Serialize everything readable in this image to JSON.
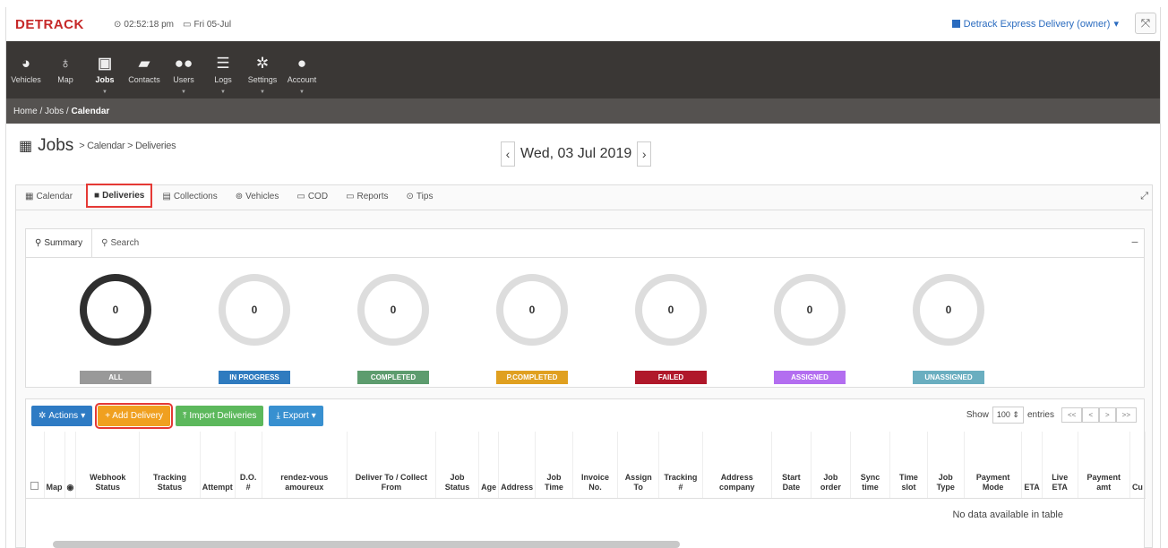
{
  "app": {
    "logo": "DETRACK",
    "time": "02:52:18 pm",
    "date": "Fri 05-Jul",
    "company": "Detrack Express Delivery (owner)"
  },
  "nav": [
    {
      "label": "Vehicles",
      "icon": "tachometer-icon"
    },
    {
      "label": "Map",
      "icon": "map-pin-icon"
    },
    {
      "label": "Jobs",
      "icon": "briefcase-icon",
      "active": true
    },
    {
      "label": "Contacts",
      "icon": "book-icon"
    },
    {
      "label": "Users",
      "icon": "users-icon"
    },
    {
      "label": "Logs",
      "icon": "list-icon"
    },
    {
      "label": "Settings",
      "icon": "gear-icon"
    },
    {
      "label": "Account",
      "icon": "user-icon"
    }
  ],
  "breadcrumb": {
    "home": "Home",
    "jobs": "Jobs",
    "current": "Calendar"
  },
  "page": {
    "title": "Jobs",
    "subtitle": "> Calendar > Deliveries",
    "current_date": "Wed, 03 Jul 2019"
  },
  "tabs": [
    "Calendar",
    "Deliveries",
    "Collections",
    "Vehicles",
    "COD",
    "Reports",
    "Tips"
  ],
  "subtabs": [
    "Summary",
    "Search"
  ],
  "summary": [
    {
      "value": "0",
      "label": "ALL",
      "color": "#999999"
    },
    {
      "value": "0",
      "label": "IN PROGRESS",
      "color": "#2f7bbf"
    },
    {
      "value": "0",
      "label": "COMPLETED",
      "color": "#5d9c6e"
    },
    {
      "value": "0",
      "label": "P.COMPLETED",
      "color": "#e0a020"
    },
    {
      "value": "0",
      "label": "FAILED",
      "color": "#b0182a"
    },
    {
      "value": "0",
      "label": "ASSIGNED",
      "color": "#b36ef0"
    },
    {
      "value": "0",
      "label": "UNASSIGNED",
      "color": "#6aaec0"
    }
  ],
  "toolbar": {
    "actions": "Actions",
    "add": "+ Add Delivery",
    "import": "Import Deliveries",
    "export": "Export",
    "show": "Show",
    "entries_value": "100",
    "entries": "entries",
    "pagination": [
      "<<",
      "<",
      ">",
      ">>"
    ]
  },
  "table": {
    "columns": [
      "Map",
      "Webhook Status",
      "Tracking Status",
      "Attempt",
      "D.O. #",
      "rendez-vous amoureux",
      "Deliver To / Collect From",
      "Job Status",
      "Age",
      "Address",
      "Job Time",
      "Invoice No.",
      "Assign To",
      "Tracking #",
      "Address company",
      "Start Date",
      "Job order",
      "Sync time",
      "Time slot",
      "Job Type",
      "Payment Mode",
      "ETA",
      "Live ETA",
      "Payment amt",
      "Cu"
    ],
    "empty_text": "No data available in table"
  }
}
